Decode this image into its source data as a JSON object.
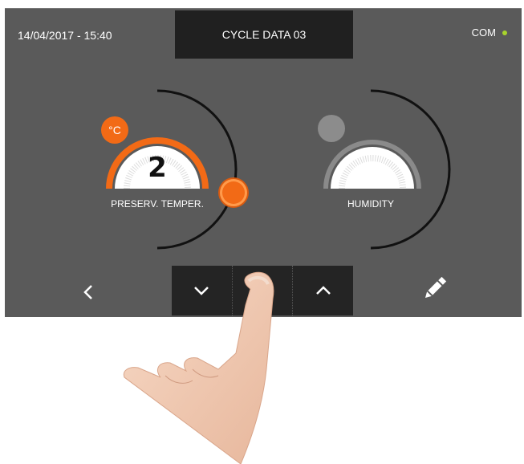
{
  "header": {
    "datetime": "14/04/2017 - 15:40",
    "title": "CYCLE DATA 03",
    "com_label": "COM",
    "com_status_color": "#a8d42c"
  },
  "dials": [
    {
      "label": "PRESERV. TEMPER.",
      "value": "2",
      "unit": "°C",
      "accent": "#f26a16",
      "active": true
    },
    {
      "label": "HUMIDITY",
      "active": false
    }
  ],
  "icons": {
    "back": "chevron-left-icon",
    "down": "chevron-down-icon",
    "confirm": "checkmark-icon",
    "up": "chevron-up-icon",
    "edit": "pencil-icon"
  },
  "colors": {
    "screen_bg": "#5a5a5a",
    "panel_dark": "#202020",
    "confirm_green": "#3cd23c"
  }
}
